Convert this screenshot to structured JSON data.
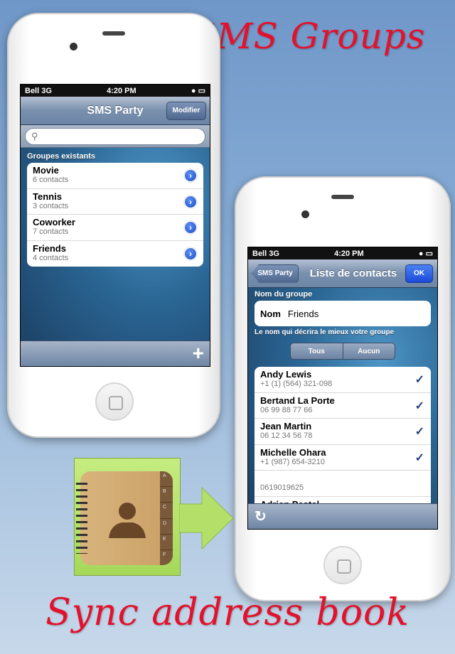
{
  "headline_top": "Manage SMS Groups",
  "headline_bottom": "Sync address book",
  "left_phone": {
    "status": {
      "carrier": "Bell 3G",
      "time": "4:20 PM"
    },
    "nav": {
      "title": "SMS Party",
      "edit_button": "Modifier"
    },
    "search": {
      "placeholder": ""
    },
    "section_header": "Groupes existants",
    "groups": [
      {
        "name": "Movie",
        "count": "6 contacts"
      },
      {
        "name": "Tennis",
        "count": "3 contacts"
      },
      {
        "name": "Coworker",
        "count": "7 contacts"
      },
      {
        "name": "Friends",
        "count": "4 contacts"
      }
    ],
    "add_icon": "+"
  },
  "right_phone": {
    "status": {
      "carrier": "Bell 3G",
      "time": "4:20 PM"
    },
    "nav": {
      "back_button": "SMS Party",
      "title": "Liste de contacts",
      "ok_button": "OK"
    },
    "group_name_header": "Nom du groupe",
    "name_field": {
      "label": "Nom",
      "value": "Friends"
    },
    "helper_text": "Le nom qui décrira le mieux votre groupe",
    "segments": [
      "Tous",
      "Aucun"
    ],
    "contacts": [
      {
        "name": "Andy Lewis",
        "phone": "+1 (1) (564) 321-098",
        "checked": true
      },
      {
        "name": "Bertand La Porte",
        "phone": "06 99 88 77 66",
        "checked": true
      },
      {
        "name": "Jean Martin",
        "phone": "06 12 34 56 78",
        "checked": true
      },
      {
        "name": "Michelle Ohara",
        "phone": "+1 (987) 654-3210",
        "checked": true
      },
      {
        "name": "",
        "phone": "0619019625",
        "checked": false
      },
      {
        "name": "Adrien Pestel",
        "phone": "",
        "checked": false
      }
    ]
  },
  "address_book_tabs": [
    "A",
    "B",
    "C",
    "D",
    "E",
    "F"
  ],
  "colors": {
    "headline": "#e4112c",
    "ok_button": "#1f57e0",
    "icon_bg": "#b4e06a"
  }
}
